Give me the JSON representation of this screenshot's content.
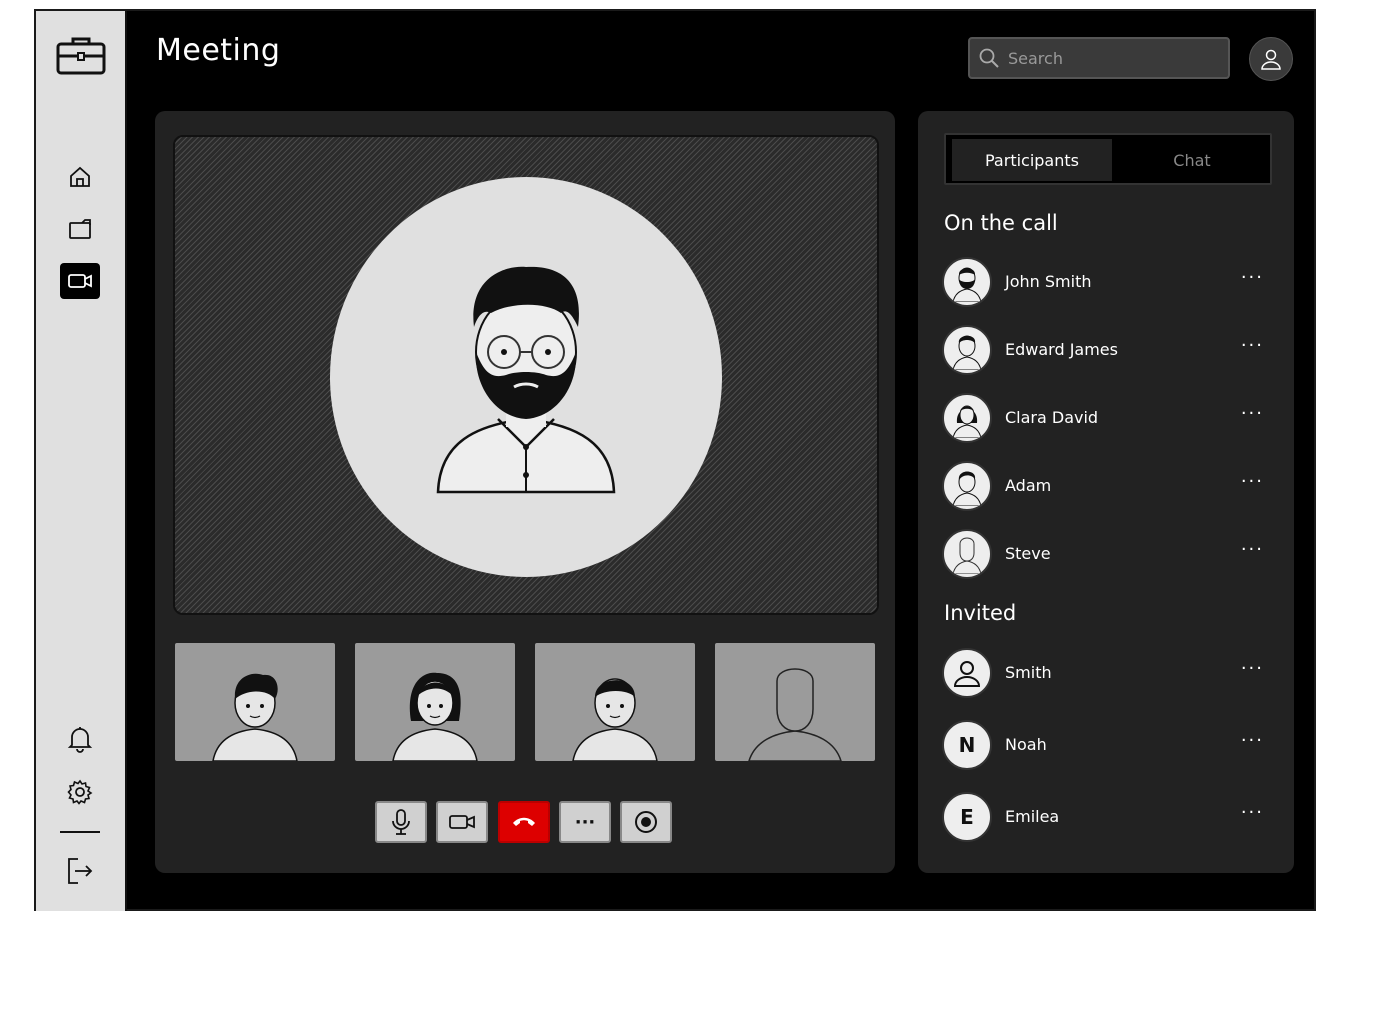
{
  "header": {
    "title": "Meeting",
    "search_placeholder": "Search"
  },
  "sidebar": {
    "top_items": [
      {
        "name": "home",
        "icon": "home-icon"
      },
      {
        "name": "files",
        "icon": "folder-icon"
      },
      {
        "name": "meetings",
        "icon": "video-camera-icon",
        "active": true
      }
    ],
    "bottom_items": [
      {
        "name": "notifications",
        "icon": "bell-icon"
      },
      {
        "name": "settings",
        "icon": "gear-icon"
      },
      {
        "name": "logout",
        "icon": "logout-icon"
      }
    ]
  },
  "tabs": {
    "participants": "Participants",
    "chat": "Chat"
  },
  "on_call": {
    "heading": "On the call",
    "people": [
      {
        "name": "John Smith",
        "more": "···"
      },
      {
        "name": "Edward James",
        "more": "···"
      },
      {
        "name": "Clara David",
        "more": "···"
      },
      {
        "name": "Adam",
        "more": "···"
      },
      {
        "name": "Steve",
        "more": "···"
      }
    ]
  },
  "invited": {
    "heading": "Invited",
    "people": [
      {
        "name": "Smith",
        "initial": "",
        "more": "···"
      },
      {
        "name": "Noah",
        "initial": "N",
        "more": "···"
      },
      {
        "name": "Emilea",
        "initial": "E",
        "more": "···"
      }
    ]
  },
  "controls": {
    "more_label": "···"
  },
  "colors": {
    "end_call": "#dd0000",
    "panel": "#222222",
    "sidebar": "#e0e0e0"
  }
}
